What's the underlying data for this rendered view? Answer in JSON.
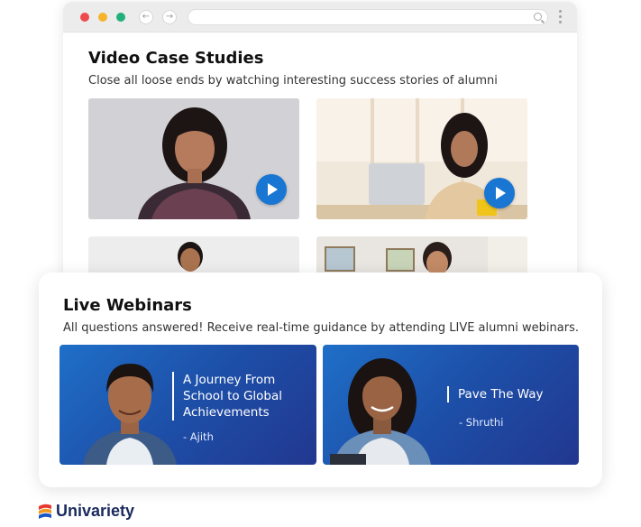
{
  "video_case_studies": {
    "title": "Video Case Studies",
    "subtitle": "Close all loose ends by watching interesting success stories of alumni"
  },
  "live_webinars": {
    "title": "Live Webinars",
    "subtitle": "All questions answered! Receive real-time guidance by attending LIVE alumni webinars.",
    "cards": [
      {
        "title": "A Journey From\nSchool to Global\nAchievements",
        "author": "- Ajith"
      },
      {
        "title": "Pave The Way",
        "author": "- Shruthi"
      }
    ]
  },
  "brand": {
    "name": "Univariety"
  },
  "colors": {
    "accent": "#1976d2",
    "card_gradient_start": "#1f6fc8",
    "card_gradient_end": "#22378f",
    "brand_text": "#1b2a5e"
  },
  "icons": [
    "back-arrow-icon",
    "forward-arrow-icon",
    "search-icon",
    "more-vertical-icon",
    "play-icon"
  ]
}
